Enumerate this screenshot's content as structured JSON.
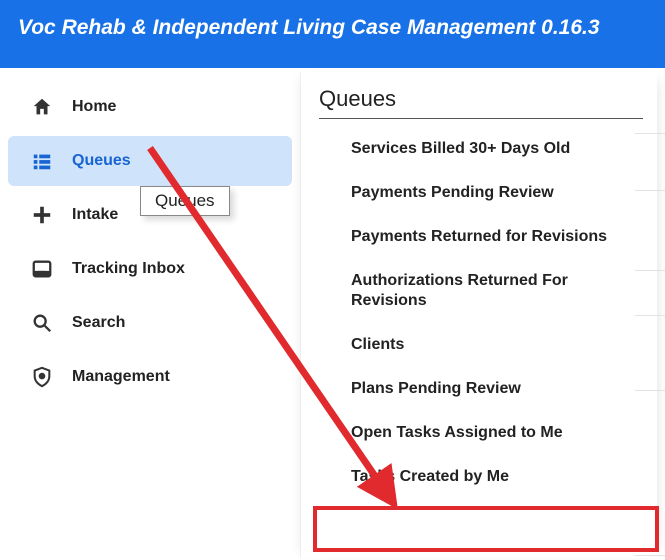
{
  "header": {
    "title": "Voc Rehab & Independent Living Case Management 0.16.3"
  },
  "sidebar": {
    "items": [
      {
        "label": "Home",
        "icon": "home-icon"
      },
      {
        "label": "Queues",
        "icon": "queues-icon"
      },
      {
        "label": "Intake",
        "icon": "plus-icon"
      },
      {
        "label": "Tracking Inbox",
        "icon": "inbox-icon"
      },
      {
        "label": "Search",
        "icon": "search-icon"
      },
      {
        "label": "Management",
        "icon": "shield-icon"
      }
    ],
    "active_index": 1
  },
  "tooltip": {
    "text": "Queues"
  },
  "panel": {
    "title": "Queues",
    "items": [
      "Services Billed 30+ Days Old",
      "Payments Pending Review",
      "Payments Returned for Revisions",
      "Authorizations Returned For Revisions",
      "Clients",
      "Plans Pending Review",
      "Open Tasks Assigned to Me",
      "Tasks Created by Me"
    ]
  },
  "annotation": {
    "arrow_color": "#e02a2e",
    "highlight_color": "#e02a2e"
  }
}
